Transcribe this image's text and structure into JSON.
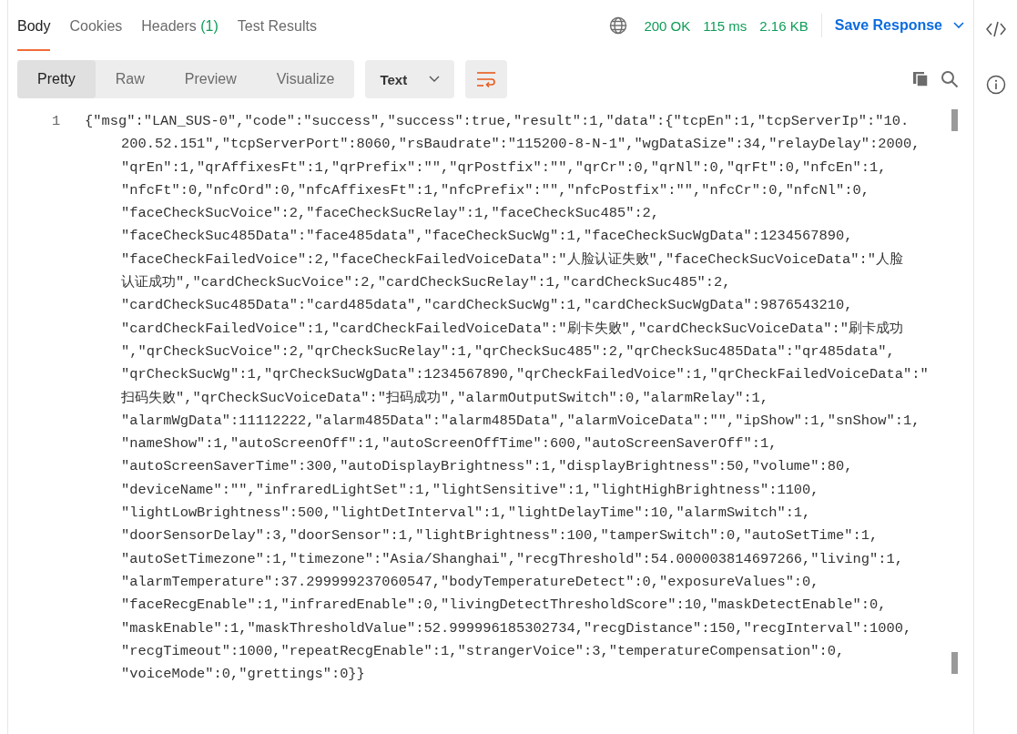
{
  "tabs": [
    {
      "label": "Body",
      "selected": true
    },
    {
      "label": "Cookies",
      "selected": false
    },
    {
      "label": "Headers",
      "count": "(1)",
      "selected": false
    },
    {
      "label": "Test Results",
      "selected": false
    }
  ],
  "status": {
    "code": "200 OK",
    "time": "115 ms",
    "size": "2.16 KB"
  },
  "save_button": "Save Response",
  "view_modes": [
    {
      "label": "Pretty",
      "selected": true
    },
    {
      "label": "Raw",
      "selected": false
    },
    {
      "label": "Preview",
      "selected": false
    },
    {
      "label": "Visualize",
      "selected": false
    }
  ],
  "format": "Text",
  "wrap_lines": true,
  "code": {
    "line_number": "1",
    "lines": [
      "{\"msg\":\"LAN_SUS-0\",\"code\":\"success\",\"success\":true,\"result\":1,\"data\":{\"tcpEn\":1,\"tcpServerIp\":\"10.",
      "200.52.151\",\"tcpServerPort\":8060,\"rsBaudrate\":\"115200-8-N-1\",\"wgDataSize\":34,\"relayDelay\":2000,",
      "\"qrEn\":1,\"qrAffixesFt\":1,\"qrPrefix\":\"\",\"qrPostfix\":\"\",\"qrCr\":0,\"qrNl\":0,\"qrFt\":0,\"nfcEn\":1,",
      "\"nfcFt\":0,\"nfcOrd\":0,\"nfcAffixesFt\":1,\"nfcPrefix\":\"\",\"nfcPostfix\":\"\",\"nfcCr\":0,\"nfcNl\":0,",
      "\"faceCheckSucVoice\":2,\"faceCheckSucRelay\":1,\"faceCheckSuc485\":2,",
      "\"faceCheckSuc485Data\":\"face485data\",\"faceCheckSucWg\":1,\"faceCheckSucWgData\":1234567890,",
      "\"faceCheckFailedVoice\":2,\"faceCheckFailedVoiceData\":\"人脸认证失败\",\"faceCheckSucVoiceData\":\"人脸",
      "认证成功\",\"cardCheckSucVoice\":2,\"cardCheckSucRelay\":1,\"cardCheckSuc485\":2,",
      "\"cardCheckSuc485Data\":\"card485data\",\"cardCheckSucWg\":1,\"cardCheckSucWgData\":9876543210,",
      "\"cardCheckFailedVoice\":1,\"cardCheckFailedVoiceData\":\"刷卡失败\",\"cardCheckSucVoiceData\":\"刷卡成功",
      "\",\"qrCheckSucVoice\":2,\"qrCheckSucRelay\":1,\"qrCheckSuc485\":2,\"qrCheckSuc485Data\":\"qr485data\",",
      "\"qrCheckSucWg\":1,\"qrCheckSucWgData\":1234567890,\"qrCheckFailedVoice\":1,\"qrCheckFailedVoiceData\":\"",
      "扫码失败\",\"qrCheckSucVoiceData\":\"扫码成功\",\"alarmOutputSwitch\":0,\"alarmRelay\":1,",
      "\"alarmWgData\":11112222,\"alarm485Data\":\"alarm485Data\",\"alarmVoiceData\":\"\",\"ipShow\":1,\"snShow\":1,",
      "\"nameShow\":1,\"autoScreenOff\":1,\"autoScreenOffTime\":600,\"autoScreenSaverOff\":1,",
      "\"autoScreenSaverTime\":300,\"autoDisplayBrightness\":1,\"displayBrightness\":50,\"volume\":80,",
      "\"deviceName\":\"\",\"infraredLightSet\":1,\"lightSensitive\":1,\"lightHighBrightness\":1100,",
      "\"lightLowBrightness\":500,\"lightDetInterval\":1,\"lightDelayTime\":10,\"alarmSwitch\":1,",
      "\"doorSensorDelay\":3,\"doorSensor\":1,\"lightBrightness\":100,\"tamperSwitch\":0,\"autoSetTime\":1,",
      "\"autoSetTimezone\":1,\"timezone\":\"Asia/Shanghai\",\"recgThreshold\":54.000003814697266,\"living\":1,",
      "\"alarmTemperature\":37.299999237060547,\"bodyTemperatureDetect\":0,\"exposureValues\":0,",
      "\"faceRecgEnable\":1,\"infraredEnable\":0,\"livingDetectThresholdScore\":10,\"maskDetectEnable\":0,",
      "\"maskEnable\":1,\"maskThresholdValue\":52.999996185302734,\"recgDistance\":150,\"recgInterval\":1000,",
      "\"recgTimeout\":1000,\"repeatRecgEnable\":1,\"strangerVoice\":3,\"temperatureCompensation\":0,",
      "\"voiceMode\":0,\"grettings\":0}}"
    ]
  }
}
